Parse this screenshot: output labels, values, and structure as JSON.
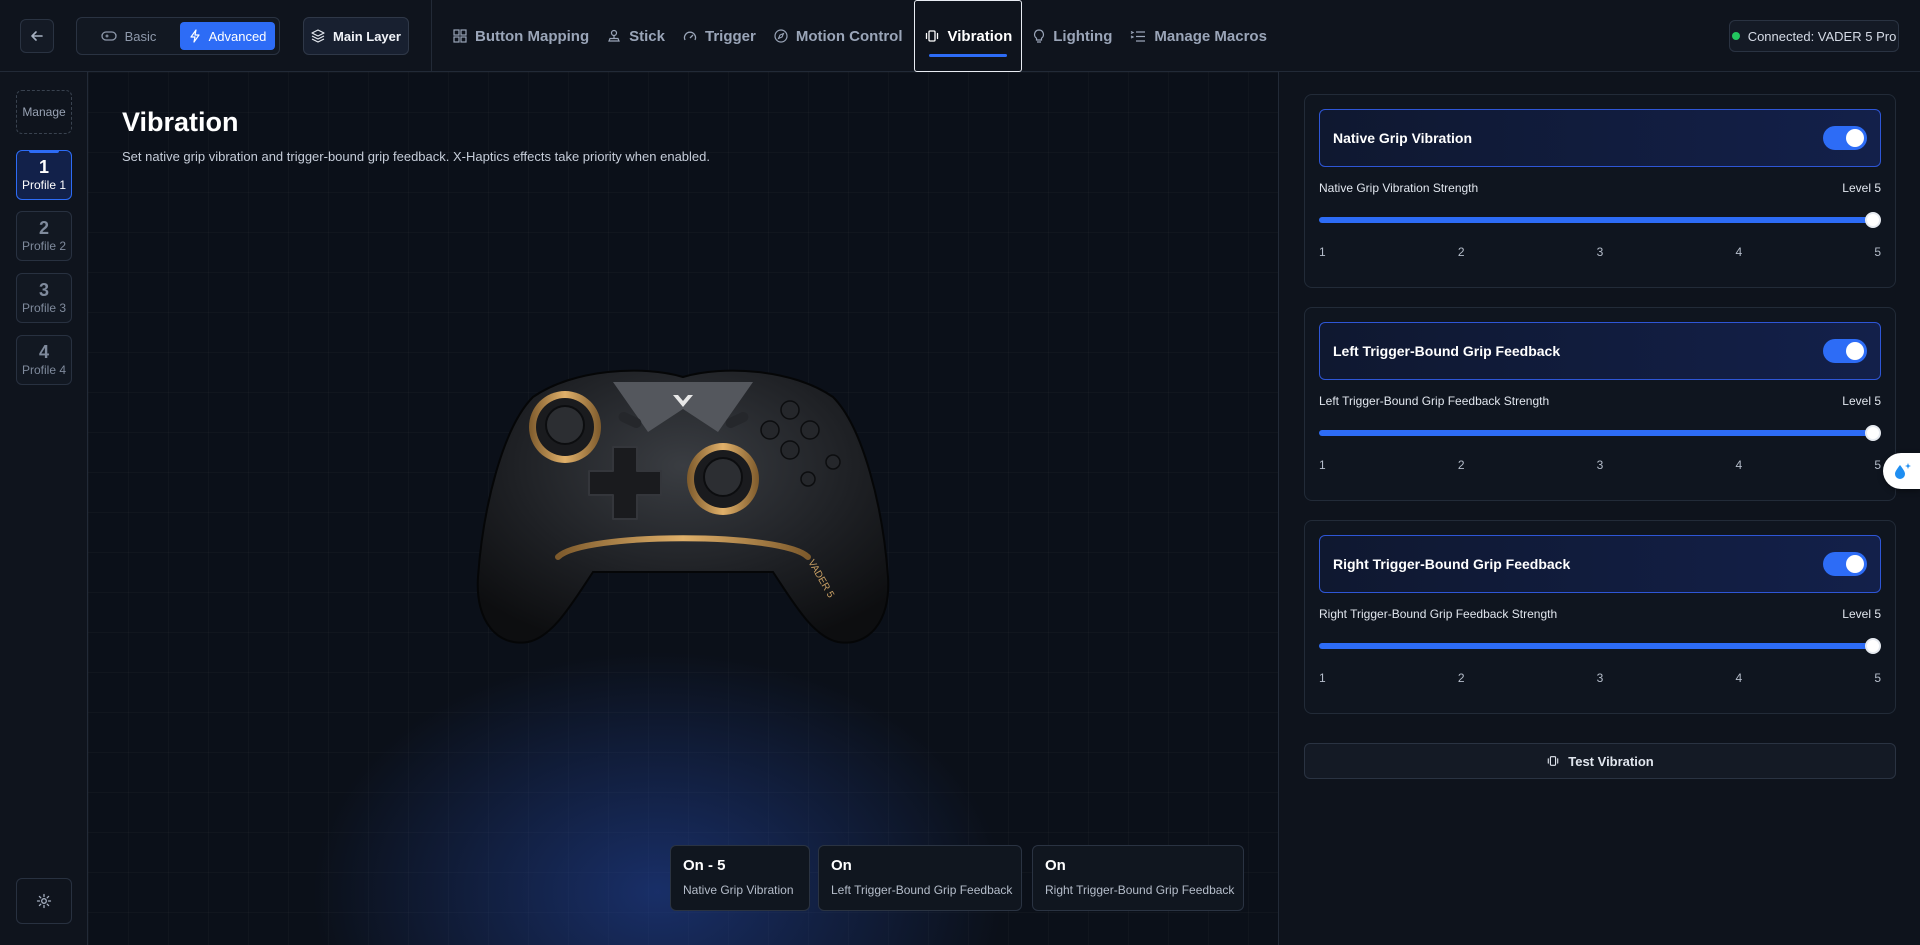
{
  "topbar": {
    "mode": {
      "basic": "Basic",
      "advanced": "Advanced"
    },
    "layer_label": "Main Layer",
    "nav": [
      {
        "label": "Button Mapping",
        "icon": "grid-icon"
      },
      {
        "label": "Stick",
        "icon": "joystick-icon"
      },
      {
        "label": "Trigger",
        "icon": "gauge-icon"
      },
      {
        "label": "Motion Control",
        "icon": "compass-icon"
      },
      {
        "label": "Vibration",
        "icon": "vibration-icon",
        "active": true
      },
      {
        "label": "Lighting",
        "icon": "lightbulb-icon"
      },
      {
        "label": "Manage Macros",
        "icon": "macro-list-icon"
      }
    ],
    "connection": "Connected: VADER 5 Pro"
  },
  "sidebar": {
    "manage": "Manage",
    "profiles": [
      {
        "num": "1",
        "label": "Profile 1",
        "active": true
      },
      {
        "num": "2",
        "label": "Profile 2"
      },
      {
        "num": "3",
        "label": "Profile 3"
      },
      {
        "num": "4",
        "label": "Profile 4"
      }
    ]
  },
  "main": {
    "title": "Vibration",
    "subtitle": "Set native grip vibration and trigger-bound grip feedback. X-Haptics effects take priority when enabled.",
    "controller_brand_text": "VADER 5",
    "status_cards": [
      {
        "value": "On - 5",
        "label": "Native Grip Vibration"
      },
      {
        "value": "On",
        "label": "Left Trigger-Bound Grip Feedback"
      },
      {
        "value": "On",
        "label": "Right Trigger-Bound Grip Feedback"
      }
    ]
  },
  "panel": {
    "sections": [
      {
        "toggle_label": "Native Grip Vibration",
        "enabled": true,
        "strength_label": "Native Grip Vibration Strength",
        "level_text": "Level 5",
        "level": 5
      },
      {
        "toggle_label": "Left Trigger-Bound Grip Feedback",
        "enabled": true,
        "strength_label": "Left Trigger-Bound Grip Feedback Strength",
        "level_text": "Level 5",
        "level": 5
      },
      {
        "toggle_label": "Right Trigger-Bound Grip Feedback",
        "enabled": true,
        "strength_label": "Right Trigger-Bound Grip Feedback Strength",
        "level_text": "Level 5",
        "level": 5
      }
    ],
    "ticks": [
      "1",
      "2",
      "3",
      "4",
      "5"
    ],
    "test_button": "Test Vibration"
  },
  "colors": {
    "accent": "#2d6cf6",
    "background": "#0e131c",
    "connected": "#22c55e"
  }
}
